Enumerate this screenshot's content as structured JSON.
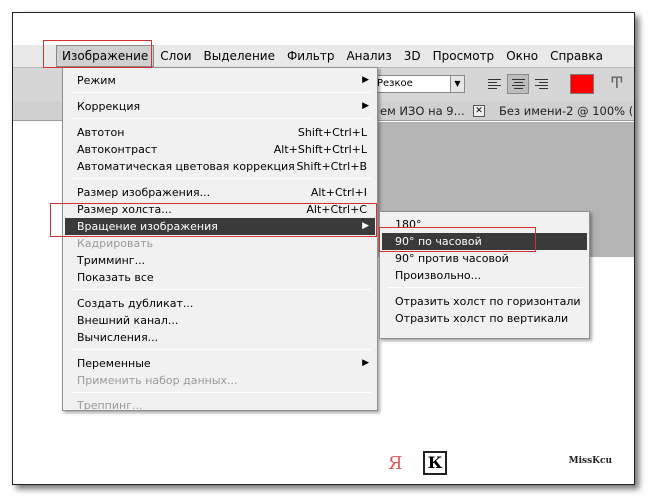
{
  "menubar": {
    "items": [
      "Изображение",
      "Слои",
      "Выделение",
      "Фильтр",
      "Анализ",
      "3D",
      "Просмотр",
      "Окно",
      "Справка"
    ]
  },
  "options": {
    "antialias": "Резкое",
    "color": "#ff0000"
  },
  "doc_tabs": [
    "ем ИЗО на  9...",
    "Без имени-2 @ 100% ("
  ],
  "image_menu": {
    "items": [
      {
        "label": "Режим",
        "shortcut": "",
        "submenu": true
      },
      {
        "label": "Коррекция",
        "shortcut": "",
        "submenu": true
      },
      {
        "label": "Автотон",
        "shortcut": "Shift+Ctrl+L"
      },
      {
        "label": "Автоконтраст",
        "shortcut": "Alt+Shift+Ctrl+L"
      },
      {
        "label": "Автоматическая цветовая коррекция",
        "shortcut": "Shift+Ctrl+B"
      },
      {
        "label": "Размер изображения...",
        "shortcut": "Alt+Ctrl+I"
      },
      {
        "label": "Размер холста...",
        "shortcut": "Alt+Ctrl+C"
      },
      {
        "label": "Вращение изображения",
        "shortcut": "",
        "submenu": true
      },
      {
        "label": "Кадрировать",
        "shortcut": "",
        "disabled": true
      },
      {
        "label": "Тримминг...",
        "shortcut": ""
      },
      {
        "label": "Показать все",
        "shortcut": ""
      },
      {
        "label": "Создать дубликат...",
        "shortcut": ""
      },
      {
        "label": "Внешний канал...",
        "shortcut": ""
      },
      {
        "label": "Вычисления...",
        "shortcut": ""
      },
      {
        "label": "Переменные",
        "shortcut": "",
        "submenu": true
      },
      {
        "label": "Применить набор данных...",
        "shortcut": "",
        "disabled": true
      },
      {
        "label": "Треппинг...",
        "shortcut": "",
        "disabled": true
      }
    ]
  },
  "rotate_submenu": {
    "items": [
      "180°",
      "90° по часовой",
      "90° против часовой",
      "Произвольно...",
      "Отразить холст по горизонтали",
      "Отразить холст по вертикали"
    ]
  },
  "footer": {
    "letter": "Я",
    "glyph": "К",
    "watermark": "MissKcu"
  }
}
